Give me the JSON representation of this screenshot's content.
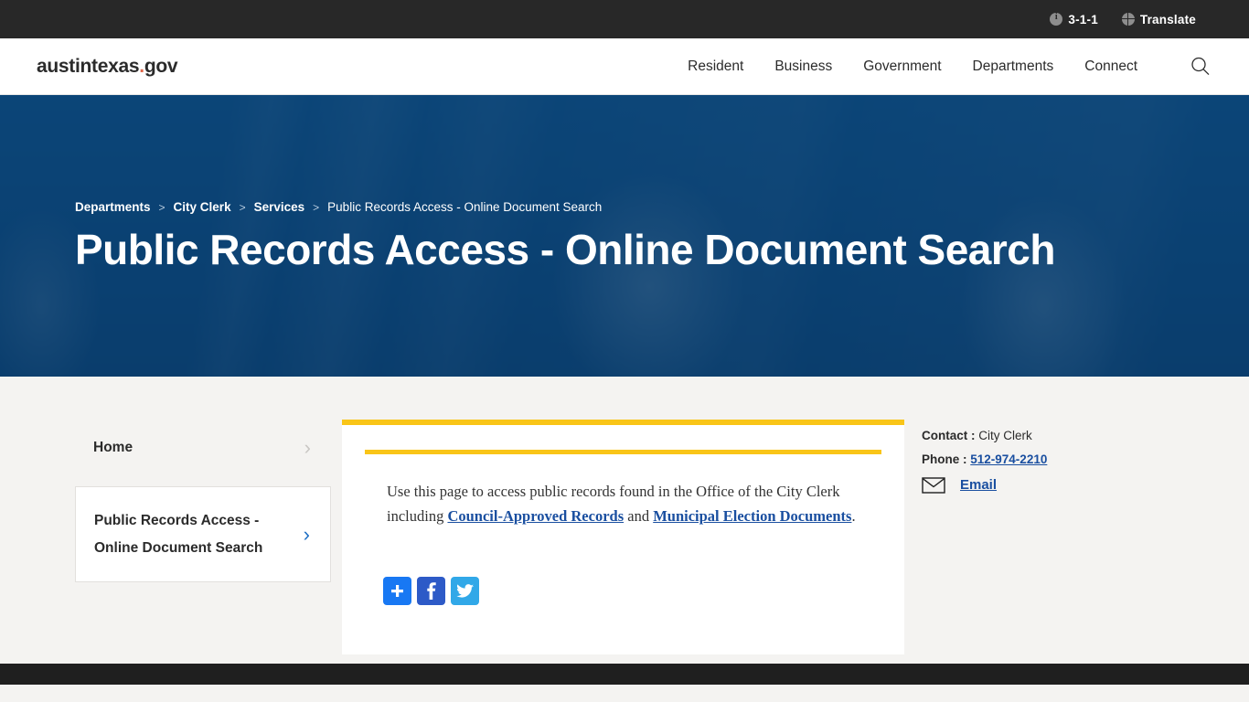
{
  "utility_bar": {
    "items": [
      {
        "icon": "info-icon",
        "label": "3-1-1"
      },
      {
        "icon": "globe-icon",
        "label": "Translate"
      }
    ]
  },
  "header": {
    "logo_main": "austintexas",
    "logo_dot": ".",
    "logo_tld": "gov",
    "nav": [
      {
        "label": "Resident"
      },
      {
        "label": "Business"
      },
      {
        "label": "Government"
      },
      {
        "label": "Departments"
      },
      {
        "label": "Connect"
      }
    ],
    "search_icon": "search-icon"
  },
  "hero": {
    "breadcrumb": [
      {
        "label": "Departments",
        "current": false
      },
      {
        "label": "City Clerk",
        "current": false
      },
      {
        "label": "Services",
        "current": false
      },
      {
        "label": "Public Records Access - Online Document Search",
        "current": true
      }
    ],
    "separator": ">",
    "title": "Public Records Access - Online Document Search",
    "overlay_color": "#0a3e6e"
  },
  "sidebar": {
    "items": [
      {
        "label": "Home",
        "active": false,
        "chevron": "chevron-right-icon"
      },
      {
        "label": "Public Records Access - Online Document Search",
        "active": true,
        "chevron": "chevron-right-icon"
      }
    ]
  },
  "main": {
    "accent_color": "#f9c518",
    "body": {
      "part1": " Use this page to access public records found in the Office of the City Clerk including ",
      "link1": "Council-Approved Records",
      "part2": " and ",
      "link2": "Municipal Election Documents",
      "part3": "."
    },
    "share": [
      {
        "name": "addthis-share-button",
        "label": "Share",
        "color": "#1878f3"
      },
      {
        "name": "facebook-share-button",
        "label": "Facebook",
        "color": "#2d5ac7"
      },
      {
        "name": "twitter-share-button",
        "label": "Twitter",
        "color": "#31a8e8"
      }
    ]
  },
  "contact": {
    "contact_label": "Contact :",
    "contact_value": "City Clerk",
    "phone_label": "Phone :",
    "phone_value": "512-974-2210",
    "email_label": "Email",
    "email_icon": "envelope-icon"
  }
}
